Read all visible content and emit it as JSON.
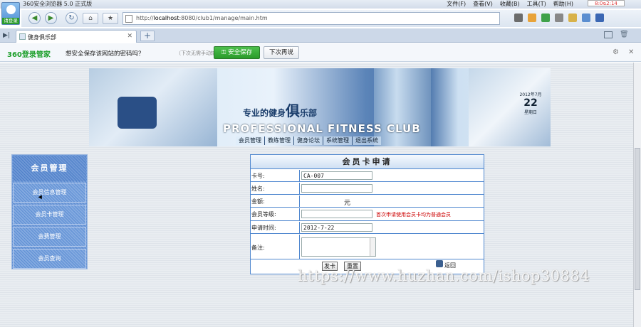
{
  "browser": {
    "window_title": "360安全浏览器 5.0 正式版",
    "menu": [
      "文件(F)",
      "查看(V)",
      "收藏(B)",
      "工具(T)",
      "帮助(H)"
    ],
    "clock": "8:0ฉ2:14",
    "avatar_label": "请登录",
    "url_prefix": "http://",
    "url_host": "localhost",
    "url_rest": ":8080/club1/manage/main.htm",
    "tab_title": "健身俱乐部",
    "new_tab_symbol": "+"
  },
  "password_bar": {
    "logo": "360登录管家",
    "question": "想安全保存该网站的密码吗？",
    "hint": "（下次无需手动输入）",
    "save_label": "安全保存",
    "later_label": "下次再说"
  },
  "banner": {
    "slogan_a": "专业的健身",
    "slogan_big": "俱",
    "slogan_b": "乐部",
    "english": "PROFESSIONAL FITNESS CLUB",
    "cal_month": "2012年7月",
    "cal_day": "22",
    "cal_week": "星期日",
    "nav": [
      "会员管理",
      "教练管理",
      "健身论坛",
      "系统管理",
      "退出系统"
    ]
  },
  "sidebar": {
    "title": "会员管理",
    "items": [
      "会员信息管理",
      "会员卡管理",
      "会费管理",
      "会员查询"
    ]
  },
  "form": {
    "title": "会员卡申请",
    "card_no_label": "卡号:",
    "card_no_value": "CA-007",
    "name_label": "姓名:",
    "name_value": "",
    "amount_label": "金额:",
    "amount_unit": "元",
    "level_label": "会员等级:",
    "level_note": "首次申请使用会员卡均为普通会员",
    "date_label": "申请时间:",
    "date_value": "2012-7-22",
    "remark_label": "备注:",
    "submit_label": "发卡",
    "reset_label": "重置",
    "back_label": "返回"
  },
  "watermark": "https://www.huzhan.com/ishop30884"
}
